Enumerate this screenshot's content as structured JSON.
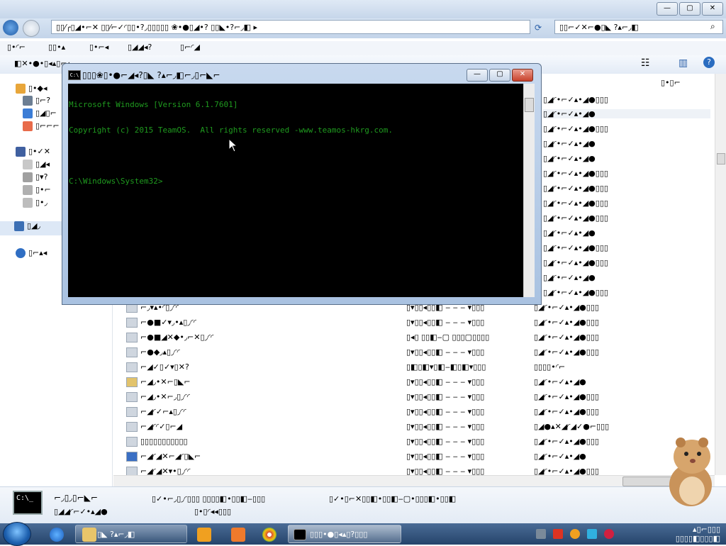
{
  "explorer": {
    "address": "▯▯⁄╭▯◢•⌐✕ ▯▯⁄⌐✓◜▯▯•?◞▯▯▯▯▯ ❀•●▯◢•?  ▯▯◣•?⌐◞◧ ▸",
    "search_placeholder": "▯▯⌐✓✕⌐●▯◣ ?▴⌐◞◧",
    "menu": [
      "▯•◜⌐",
      "▯▯•▴",
      "▯•⌐◂",
      "▯◢◢◂?",
      "▯⌐◜◢"
    ],
    "toolbar_label": "◧✕•●•▯◂▴▯⌐▴",
    "window_controls": {
      "minimize": "—",
      "maximize": "▢",
      "close": "✕"
    }
  },
  "navpane": {
    "items": [
      "▯•◆◂",
      "▯⌐?",
      "▯◢▯⌐",
      "▯⌐⌐⌐",
      "▯•✓✕",
      "▯◢◂",
      "▯▾?",
      "▯•⌐",
      "▯•◞",
      "▯◢◞",
      "▯⌐▴◂"
    ]
  },
  "files": {
    "rows": [
      {
        "name": "⌐◞▾▴•◜▯◞◜◜",
        "date": "▯▾▯▯◂▯▯◧ ‒ ‒ ‒ ▾▯▯▯",
        "type": "▯◢◜•⌐✓▴•◢●▯▯▯"
      },
      {
        "name": "⌐●■✓▾◞•▴▯◞◜◜",
        "date": "▯▾▯▯◂▯▯◧ ‒ ‒ ‒ ▾▯▯▯",
        "type": "▯◢◜•⌐✓▴•◢●▯▯▯"
      },
      {
        "name": "⌐●■◢✕◆•◞⌐✕▯◞◜◜",
        "date": "▯◂▯ ▯▯◧‒▢ ▯▯▯▢▯▯▯▯",
        "type": "▯◢◜•⌐✓▴•◢●▯▯▯"
      },
      {
        "name": "⌐●◆◞▴▯◞◜◜",
        "date": "▯▾▯▯◂▯▯◧ ‒ ‒ ‒ ▾▯▯▯",
        "type": "▯◢◜•⌐✓▴•◢●▯▯▯"
      },
      {
        "name": "⌐◢✓▯✓▾▯✕?",
        "date": "▯◧▯◧▾▯◧‒◧▯◧▾▯▯▯",
        "type": "▯▯▯▯•◜⌐"
      },
      {
        "name": "⌐◢◞•✕⌐▯◣⌐",
        "date": "▯▾▯▯◂▯▯◧ ‒ ‒ ‒ ▾▯▯▯",
        "type": "▯◢◜•⌐✓▴•◢●"
      },
      {
        "name": "⌐◢◞•✕⌐◞▯◞◜◜",
        "date": "▯▾▯▯◂▯▯◧ ‒ ‒ ‒ ▾▯▯▯",
        "type": "▯◢◜•⌐✓▴•◢●▯▯▯"
      },
      {
        "name": "⌐◢◜✓⌐▴▯◞◜◜",
        "date": "▯▾▯▯◂▯▯◧ ‒ ‒ ‒ ▾▯▯▯",
        "type": "▯◢◜•⌐✓▴•◢●▯▯▯"
      },
      {
        "name": "⌐◢◜◜✓▯⌐◢",
        "date": "▯▾▯▯◂▯▯◧ ‒ ‒ ‒ ▾▯▯▯",
        "type": "▯◢●▴✕◢◜◢✓●⌐▯▯▯"
      },
      {
        "name": "▯▯▯▯▯▯▯▯▯▯▯",
        "date": "▯▾▯▯◂▯▯◧ ‒ ‒ ‒ ▾▯▯▯",
        "type": "▯◢◜•⌐✓▴•◢●▯▯▯"
      },
      {
        "name": "⌐◢◜◢✕⌐◢◜▯◣⌐",
        "date": "▯▾▯▯◂▯▯◧ ‒ ‒ ‒ ▾▯▯▯",
        "type": "▯◢◜•⌐✓▴•◢●"
      },
      {
        "name": "⌐◢◜◢✕▾•▯◞◜◜",
        "date": "▯▾▯▯◂▯▯◧ ‒ ‒ ‒ ▾▯▯▯",
        "type": "▯◢◜•⌐✓▴•◢●▯▯▯"
      }
    ],
    "right_rows": [
      "▯◢◜•⌐✓▴•◢●▯▯▯",
      "▯◢◜•⌐✓▴•◢●",
      "▯◢◜•⌐✓▴•◢●▯▯▯",
      "▯◢◜•⌐✓▴•◢●",
      "▯◢◜•⌐✓▴•◢●",
      "▯◢◜•⌐✓▴•◢●▯▯▯",
      "▯◢◜•⌐✓▴•◢●▯▯▯",
      "▯◢◜•⌐✓▴•◢●▯▯▯",
      "▯◢◜•⌐✓▴•◢●▯▯▯",
      "▯◢◜•⌐✓▴•◢●",
      "▯◢◜•⌐✓▴•◢●▯▯▯",
      "▯◢◜•⌐✓▴•◢●▯▯▯",
      "▯◢◜•⌐✓▴•◢●",
      "▯◢◜•⌐✓▴•◢●▯▯▯"
    ],
    "right_header": "▯•▯⌐"
  },
  "details": {
    "name": "⌐◞▯◞▯⌐◣⌐",
    "type": "▯◢◢◜⌐✓•▴◢●",
    "modified": "▯✓•⌐◞▯◞◜▯▯▯ ▯▯▯▯◧•▯▯◧‒▯▯▯",
    "size_label": "▯•▯◜◂◂▯▯▯",
    "created": "▯✓•▯⌐✕▯▯◧•▯▯◧‒▢•▯▯▯◧•▯▯◧"
  },
  "console": {
    "title": "▯▯▯❀▯•●⌐◢◂?▯◣ ?▴⌐◞◧⌐◞▯⌐◣⌐",
    "lines": [
      "Microsoft Windows [Version 6.1.7601]",
      "Copyright (c) 2015 TeamOS.  All rights reserved -www.teamos-hkrg.com.",
      "",
      "C:\\Windows\\System32>"
    ],
    "window_controls": {
      "minimize": "—",
      "maximize": "▢",
      "close": "✕"
    },
    "icon_text": "C:\\"
  },
  "taskbar": {
    "explorer_label": "▯◣ ?▴⌐◞◧",
    "console_label": "▯▯▯•●▯◂▴▯?▯▯▯",
    "clock_line1": "▴▯⌐▯▯▯",
    "clock_line2": "▯▯▯▯◧▯▯▯◧"
  },
  "colors": {
    "console_text": "#1f9a1f",
    "console_bg": "#000000",
    "taskbar": "#2f5283"
  }
}
